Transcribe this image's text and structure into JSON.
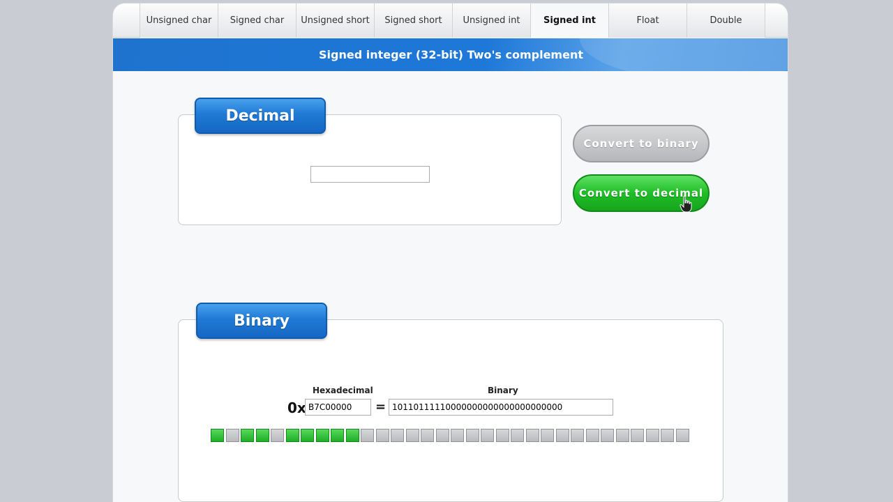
{
  "tabs": [
    {
      "label": "Unsigned char",
      "active": false
    },
    {
      "label": "Signed char",
      "active": false
    },
    {
      "label": "Unsigned short",
      "active": false
    },
    {
      "label": "Signed short",
      "active": false
    },
    {
      "label": "Unsigned int",
      "active": false
    },
    {
      "label": "Signed int",
      "active": true
    },
    {
      "label": "Float",
      "active": false
    },
    {
      "label": "Double",
      "active": false
    }
  ],
  "header": {
    "title": "Signed integer (32-bit) Two's complement"
  },
  "decimal": {
    "label": "Decimal",
    "value": ""
  },
  "buttons": {
    "to_binary": "Convert to binary",
    "to_decimal": "Convert to decimal"
  },
  "binary": {
    "label": "Binary",
    "hex_label": "Hexadecimal",
    "binary_label": "Binary",
    "hex_prefix": "0x",
    "equals": "=",
    "hex_value": "B7C00000",
    "binary_value": "10110111110000000000000000000000"
  },
  "colors": {
    "accent_blue": "#1f73cf",
    "bit_on": "#1fae25",
    "bit_off": "#b9bbbe"
  }
}
